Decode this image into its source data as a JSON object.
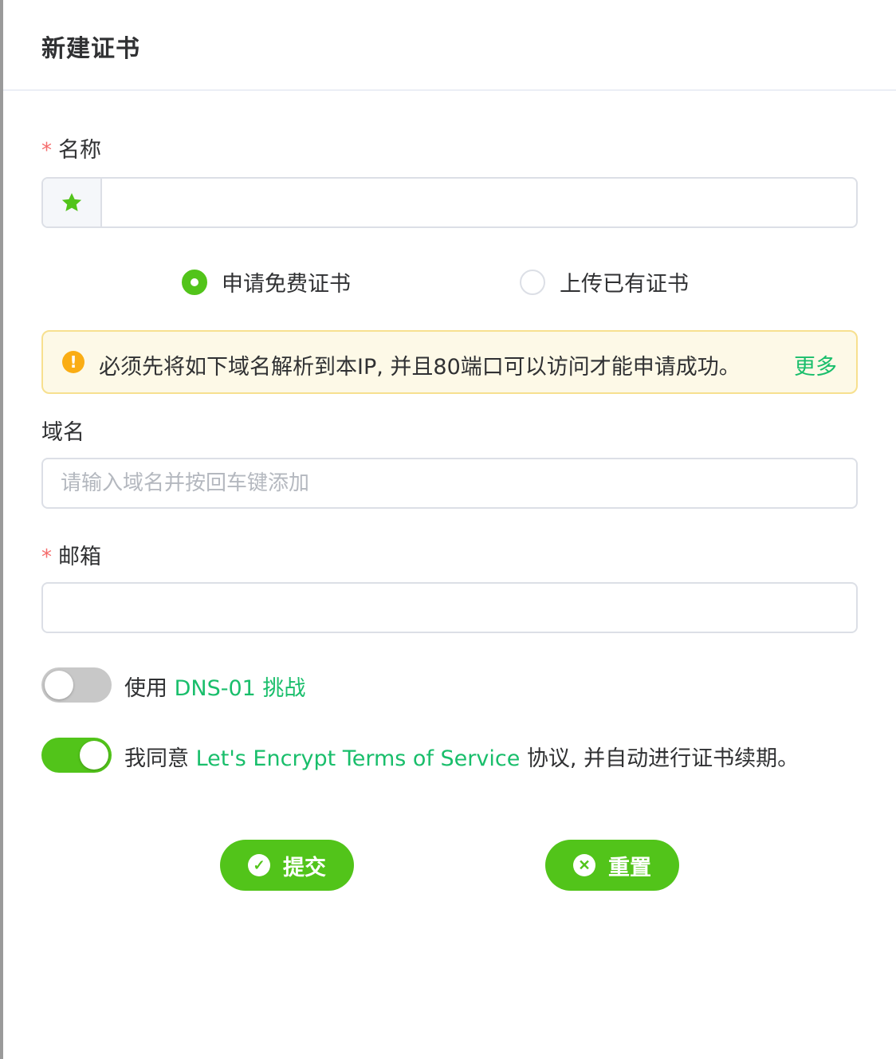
{
  "dialog": {
    "title": "新建证书"
  },
  "form": {
    "name": {
      "required_mark": "*",
      "label": "名称",
      "value": "",
      "prefix_icon": "star-icon"
    },
    "mode": {
      "options": [
        {
          "label": "申请免费证书",
          "selected": true
        },
        {
          "label": "上传已有证书",
          "selected": false
        }
      ]
    },
    "alert": {
      "icon": "warning-icon",
      "message": "必须先将如下域名解析到本IP, 并且80端口可以访问才能申请成功。",
      "more_link": "更多"
    },
    "domain": {
      "label": "域名",
      "placeholder": "请输入域名并按回车键添加",
      "value": ""
    },
    "email": {
      "required_mark": "*",
      "label": "邮箱",
      "value": ""
    },
    "dns_switch": {
      "on": false,
      "prefix": "使用",
      "link": "DNS-01 挑战"
    },
    "agree_switch": {
      "on": true,
      "prefix": "我同意",
      "link": "Let's Encrypt Terms of Service",
      "suffix": "协议, 并自动进行证书续期。"
    }
  },
  "actions": {
    "submit_label": "提交",
    "reset_label": "重置"
  },
  "colors": {
    "primary": "#52c41a",
    "link": "#19be6b",
    "warning": "#faad14",
    "required": "#f56c6c"
  }
}
